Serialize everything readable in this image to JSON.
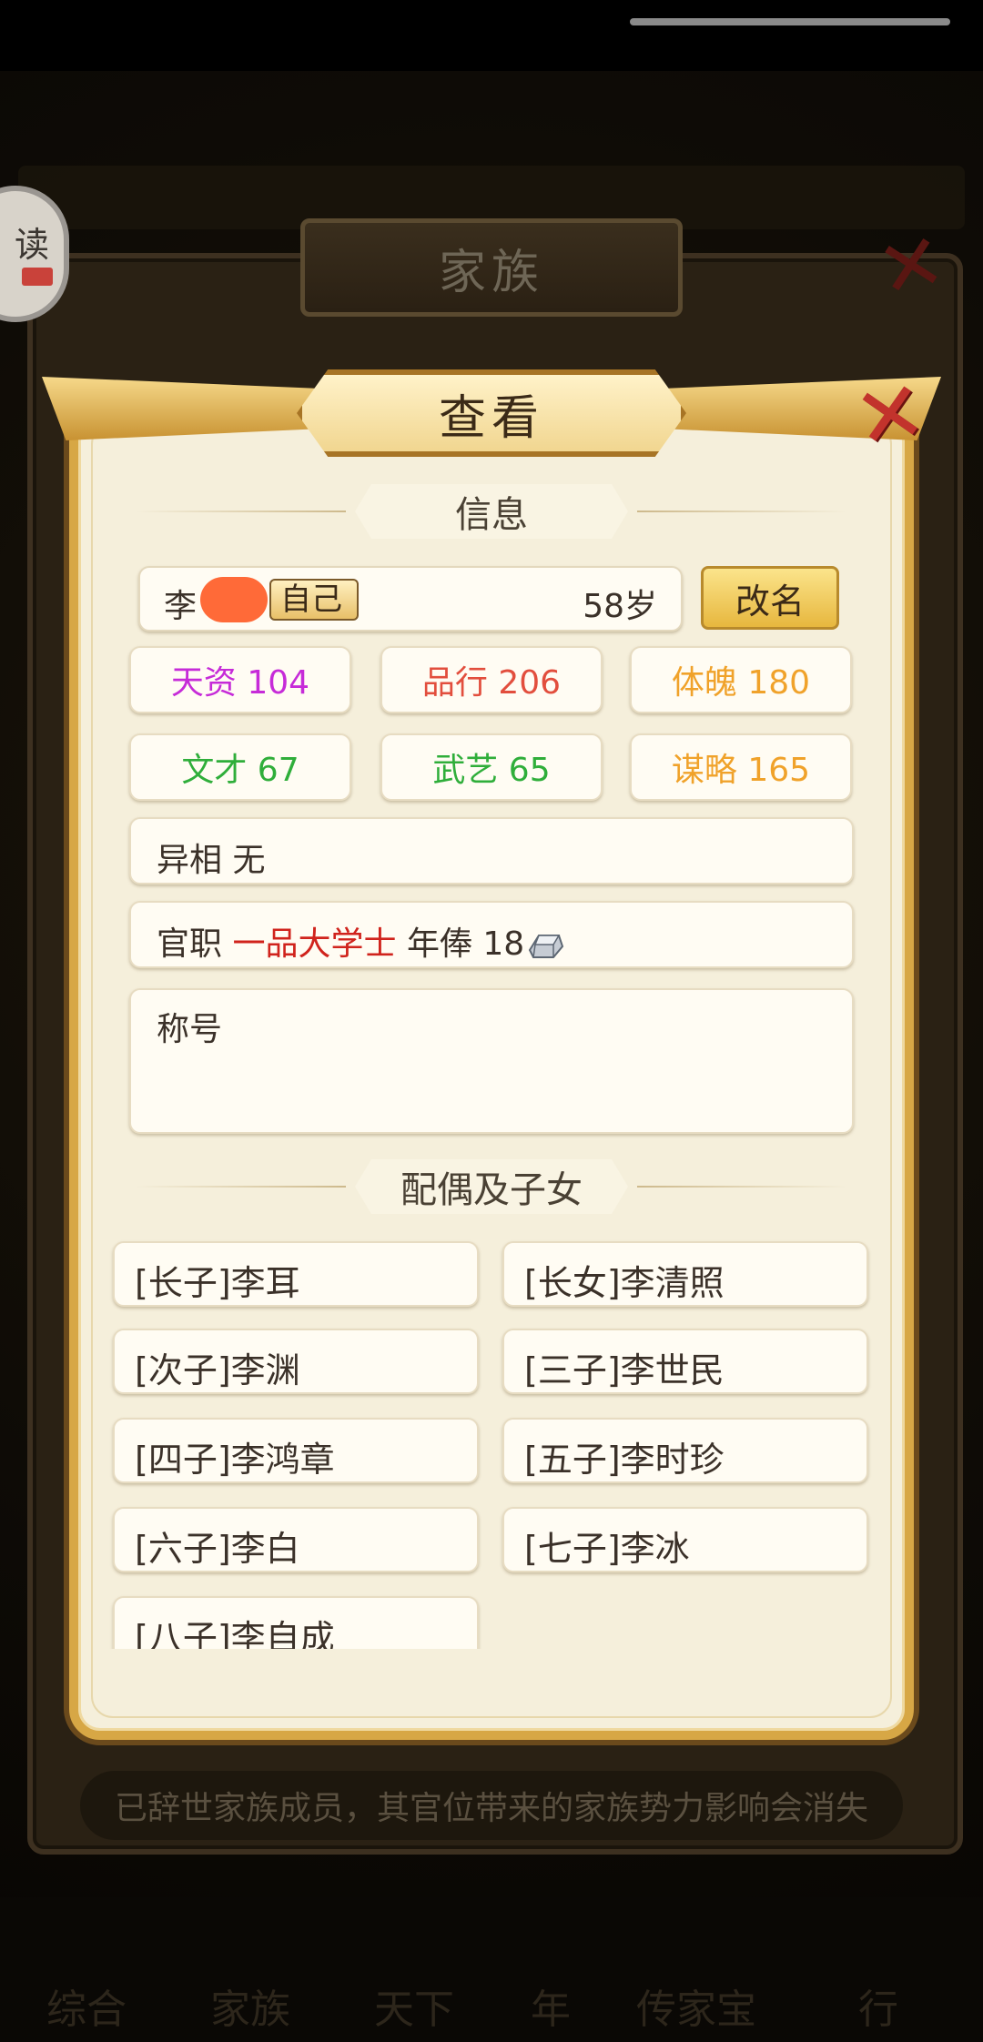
{
  "background": {
    "family_title": "家族",
    "footer_note": "已辞世家族成员，其官位带来的家族势力影响会消失",
    "nav": [
      "综合",
      "家族",
      "天下",
      "年",
      "传家宝",
      "行"
    ]
  },
  "read_badge": {
    "label": "读"
  },
  "dialog": {
    "title": "查看",
    "close_symbol": "✕",
    "info_header": "信息",
    "profile": {
      "name": "李",
      "self_tag": "自己",
      "age": "58岁",
      "rename_label": "改名"
    },
    "stats": [
      {
        "label": "天资 104",
        "color": "#c62bd8"
      },
      {
        "label": "品行 206",
        "color": "#e24e3d"
      },
      {
        "label": "体魄 180",
        "color": "#f0a22a"
      },
      {
        "label": "文才 67",
        "color": "#2fae3a"
      },
      {
        "label": "武艺 65",
        "color": "#2fae3a"
      },
      {
        "label": "谋略 165",
        "color": "#f0a22a"
      }
    ],
    "trait": {
      "label": "异相",
      "value": "无"
    },
    "office": {
      "label": "官职",
      "title": "一品大学士",
      "salary_label": "年俸",
      "salary_value": "18",
      "icon": "silver-ingot-icon"
    },
    "honor": {
      "label": "称号"
    },
    "family_header": "配偶及子女",
    "children": [
      "[长子]李耳",
      "[长女]李清照",
      "[次子]李渊",
      "[三子]李世民",
      "[四子]李鸿章",
      "[五子]李时珍",
      "[六子]李白",
      "[七子]李冰",
      "[八子]李自成"
    ]
  }
}
